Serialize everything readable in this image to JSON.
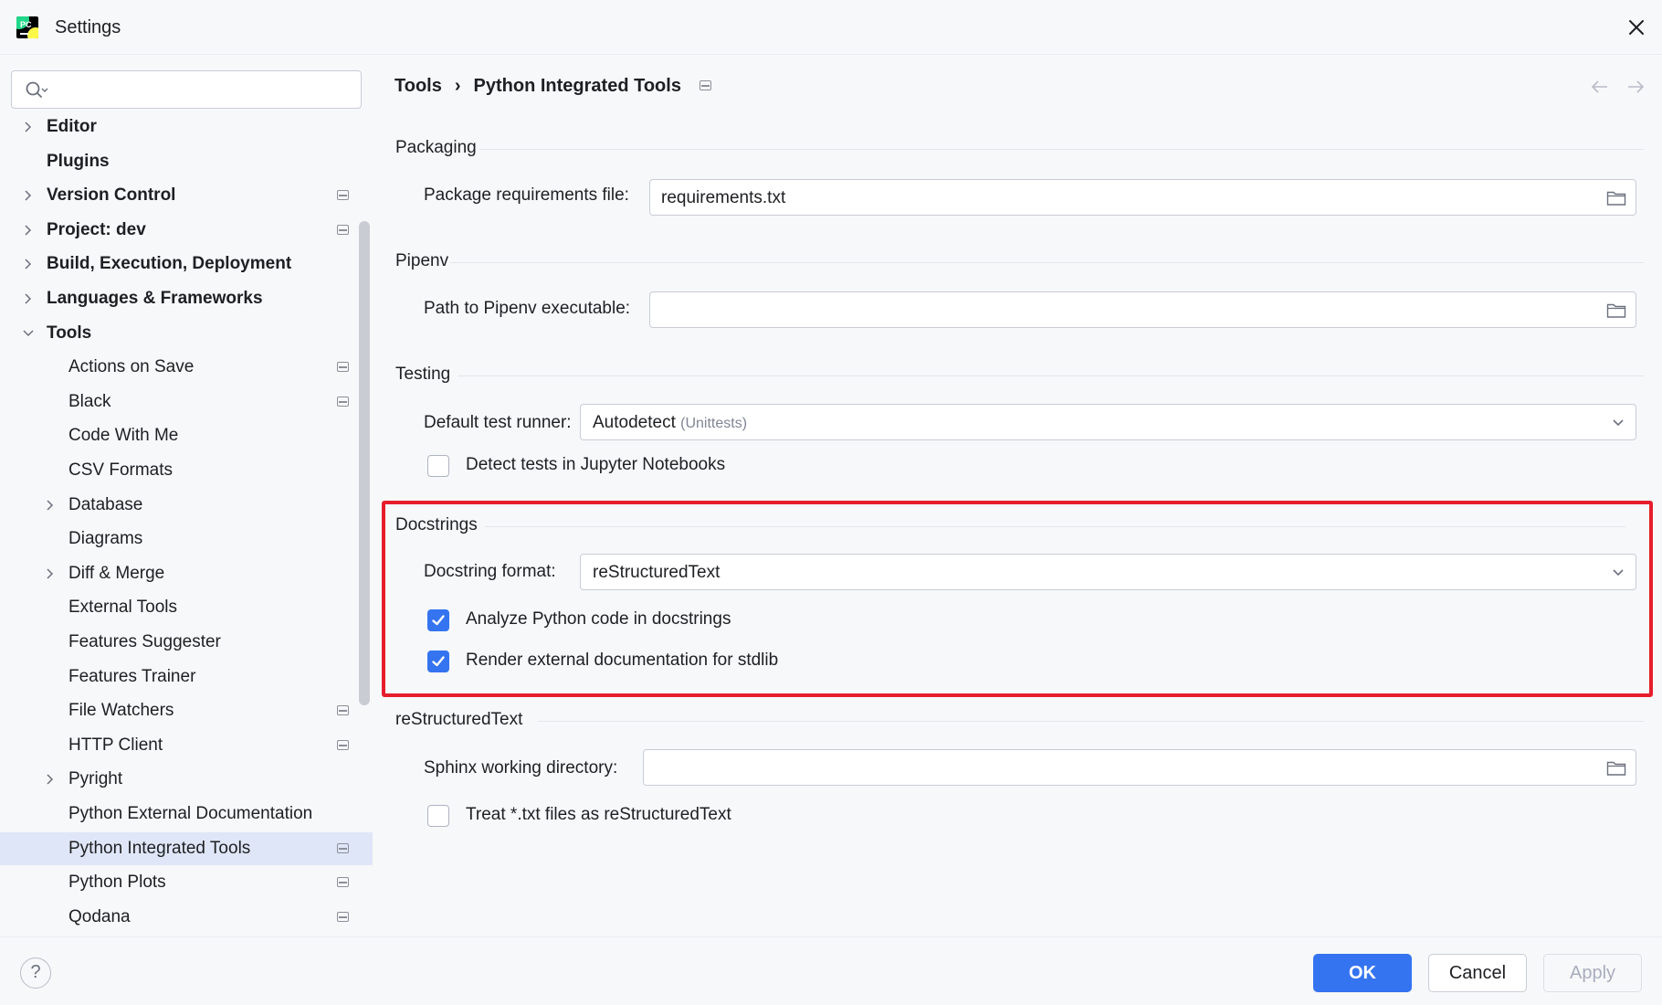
{
  "window": {
    "title": "Settings"
  },
  "search": {
    "value": "",
    "placeholder": ""
  },
  "sidebar": {
    "items": [
      {
        "label": "Editor",
        "level": 0,
        "expandable": true,
        "expanded": false,
        "bold": true,
        "project_icon": false
      },
      {
        "label": "Plugins",
        "level": 0,
        "expandable": false,
        "bold": true,
        "project_icon": false
      },
      {
        "label": "Version Control",
        "level": 0,
        "expandable": true,
        "expanded": false,
        "bold": true,
        "project_icon": true
      },
      {
        "label": "Project: dev",
        "level": 0,
        "expandable": true,
        "expanded": false,
        "bold": true,
        "project_icon": true
      },
      {
        "label": "Build, Execution, Deployment",
        "level": 0,
        "expandable": true,
        "expanded": false,
        "bold": true,
        "project_icon": false
      },
      {
        "label": "Languages & Frameworks",
        "level": 0,
        "expandable": true,
        "expanded": false,
        "bold": true,
        "project_icon": false
      },
      {
        "label": "Tools",
        "level": 0,
        "expandable": true,
        "expanded": true,
        "bold": true,
        "project_icon": false
      },
      {
        "label": "Actions on Save",
        "level": 1,
        "expandable": false,
        "project_icon": true
      },
      {
        "label": "Black",
        "level": 1,
        "expandable": false,
        "project_icon": true
      },
      {
        "label": "Code With Me",
        "level": 1,
        "expandable": false,
        "project_icon": false
      },
      {
        "label": "CSV Formats",
        "level": 1,
        "expandable": false,
        "project_icon": false
      },
      {
        "label": "Database",
        "level": 1,
        "expandable": true,
        "expanded": false,
        "project_icon": false
      },
      {
        "label": "Diagrams",
        "level": 1,
        "expandable": false,
        "project_icon": false
      },
      {
        "label": "Diff & Merge",
        "level": 1,
        "expandable": true,
        "expanded": false,
        "project_icon": false
      },
      {
        "label": "External Tools",
        "level": 1,
        "expandable": false,
        "project_icon": false
      },
      {
        "label": "Features Suggester",
        "level": 1,
        "expandable": false,
        "project_icon": false
      },
      {
        "label": "Features Trainer",
        "level": 1,
        "expandable": false,
        "project_icon": false
      },
      {
        "label": "File Watchers",
        "level": 1,
        "expandable": false,
        "project_icon": true
      },
      {
        "label": "HTTP Client",
        "level": 1,
        "expandable": false,
        "project_icon": true
      },
      {
        "label": "Pyright",
        "level": 1,
        "expandable": true,
        "expanded": false,
        "project_icon": false
      },
      {
        "label": "Python External Documentation",
        "level": 1,
        "expandable": false,
        "project_icon": false
      },
      {
        "label": "Python Integrated Tools",
        "level": 1,
        "expandable": false,
        "project_icon": true,
        "selected": true
      },
      {
        "label": "Python Plots",
        "level": 1,
        "expandable": false,
        "project_icon": true
      },
      {
        "label": "Qodana",
        "level": 1,
        "expandable": false,
        "project_icon": true
      }
    ]
  },
  "breadcrumb": {
    "parent": "Tools",
    "separator": "›",
    "current": "Python Integrated Tools"
  },
  "sections": {
    "packaging": {
      "title": "Packaging",
      "requirements_label": "Package requirements file:",
      "requirements_value": "requirements.txt"
    },
    "pipenv": {
      "title": "Pipenv",
      "path_label": "Path to Pipenv executable:",
      "path_value": ""
    },
    "testing": {
      "title": "Testing",
      "runner_label": "Default test runner:",
      "runner_value": "Autodetect",
      "runner_hint": "(Unittests)",
      "jupyter_label": "Detect tests in Jupyter Notebooks",
      "jupyter_checked": false
    },
    "docstrings": {
      "title": "Docstrings",
      "format_label": "Docstring format:",
      "format_value": "reStructuredText",
      "analyze_label": "Analyze Python code in docstrings",
      "analyze_checked": true,
      "render_label": "Render external documentation for stdlib",
      "render_checked": true
    },
    "restructuredtext": {
      "title": "reStructuredText",
      "sphinx_label": "Sphinx working directory:",
      "sphinx_value": "",
      "txt_label": "Treat *.txt files as reStructuredText",
      "txt_checked": false
    }
  },
  "footer": {
    "help_label": "?",
    "ok_label": "OK",
    "cancel_label": "Cancel",
    "apply_label": "Apply"
  },
  "colors": {
    "accent": "#3574f0",
    "highlight": "#e61e2b",
    "selection": "#dfe6f7"
  }
}
